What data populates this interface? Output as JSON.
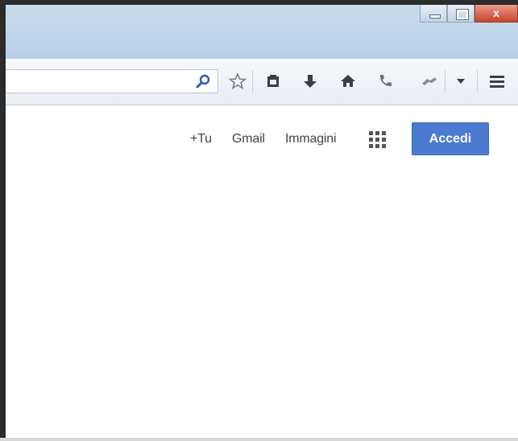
{
  "window_controls": {
    "close_label": "x"
  },
  "toolbar": {
    "url_value": "",
    "icons": [
      "search-icon",
      "star-icon",
      "clipboard-icon",
      "download-icon",
      "home-icon",
      "phone-icon",
      "extension-icon",
      "dropdown-icon",
      "menu-icon"
    ]
  },
  "google_bar": {
    "plus_you": "+Tu",
    "gmail": "Gmail",
    "images": "Immagini",
    "signin": "Accedi"
  },
  "colors": {
    "signin_bg": "#4a7bd0",
    "titlebar": "#c1d6ea",
    "close_button": "#d05a44"
  }
}
